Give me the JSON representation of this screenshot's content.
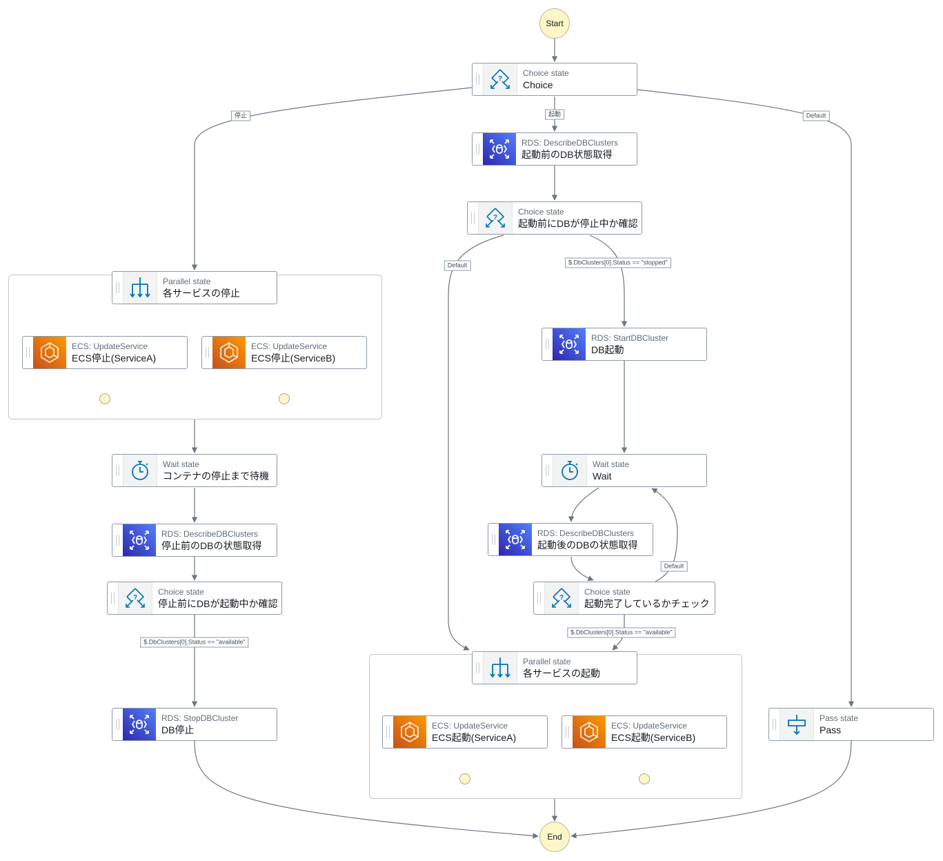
{
  "start_label": "Start",
  "end_label": "End",
  "nodes": [
    {
      "id": "choice1",
      "icon": "choice",
      "kind": "Choice state",
      "name": "Choice"
    },
    {
      "id": "rds1",
      "icon": "rds",
      "kind": "RDS: DescribeDBClusters",
      "name": "起動前のDB状態取得"
    },
    {
      "id": "choice2",
      "icon": "choice",
      "kind": "Choice state",
      "name": "起動前にDBが停止中か確認"
    },
    {
      "id": "par1",
      "icon": "parallel",
      "kind": "Parallel state",
      "name": "各サービスの停止"
    },
    {
      "id": "ecs1",
      "icon": "ecs",
      "kind": "ECS: UpdateService",
      "name": "ECS停止(ServiceA)"
    },
    {
      "id": "ecs2",
      "icon": "ecs",
      "kind": "ECS: UpdateService",
      "name": "ECS停止(ServiceB)"
    },
    {
      "id": "wait1",
      "icon": "wait",
      "kind": "Wait state",
      "name": "コンテナの停止まで待機"
    },
    {
      "id": "rds2",
      "icon": "rds",
      "kind": "RDS: DescribeDBClusters",
      "name": "停止前のDBの状態取得"
    },
    {
      "id": "choice3",
      "icon": "choice",
      "kind": "Choice state",
      "name": "停止前にDBが起動中か確認"
    },
    {
      "id": "rdsStop",
      "icon": "rds",
      "kind": "RDS: StopDBCluster",
      "name": "DB停止"
    },
    {
      "id": "rdsStart",
      "icon": "rds",
      "kind": "RDS: StartDBCluster",
      "name": "DB起動"
    },
    {
      "id": "wait2",
      "icon": "wait",
      "kind": "Wait state",
      "name": "Wait"
    },
    {
      "id": "rds3",
      "icon": "rds",
      "kind": "RDS: DescribeDBClusters",
      "name": "起動後のDBの状態取得"
    },
    {
      "id": "choice4",
      "icon": "choice",
      "kind": "Choice state",
      "name": "起動完了しているかチェック"
    },
    {
      "id": "par2",
      "icon": "parallel",
      "kind": "Parallel state",
      "name": "各サービスの起動"
    },
    {
      "id": "ecs3",
      "icon": "ecs",
      "kind": "ECS: UpdateService",
      "name": "ECS起動(ServiceA)"
    },
    {
      "id": "ecs4",
      "icon": "ecs",
      "kind": "ECS: UpdateService",
      "name": "ECS起動(ServiceB)"
    },
    {
      "id": "pass",
      "icon": "pass",
      "kind": "Pass state",
      "name": "Pass"
    }
  ],
  "edge_labels": [
    {
      "id": "l-stop",
      "text": "停止"
    },
    {
      "id": "l-start",
      "text": "起動"
    },
    {
      "id": "l-default1",
      "text": "Default"
    },
    {
      "id": "l-default2",
      "text": "Default"
    },
    {
      "id": "l-stopped",
      "text": "$.DbClusters[0].Status == \"stopped\""
    },
    {
      "id": "l-default3",
      "text": "Default"
    },
    {
      "id": "l-available1",
      "text": "$.DbClusters[0].Status == \"available\""
    },
    {
      "id": "l-available2",
      "text": "$.DbClusters[0].Status == \"available\""
    }
  ],
  "colors": {
    "rds": "#3b48cc",
    "ecs": "#e7711b",
    "icon": "#0073bb",
    "edge": "#6b7682",
    "terminal": "#fdf6c8"
  }
}
